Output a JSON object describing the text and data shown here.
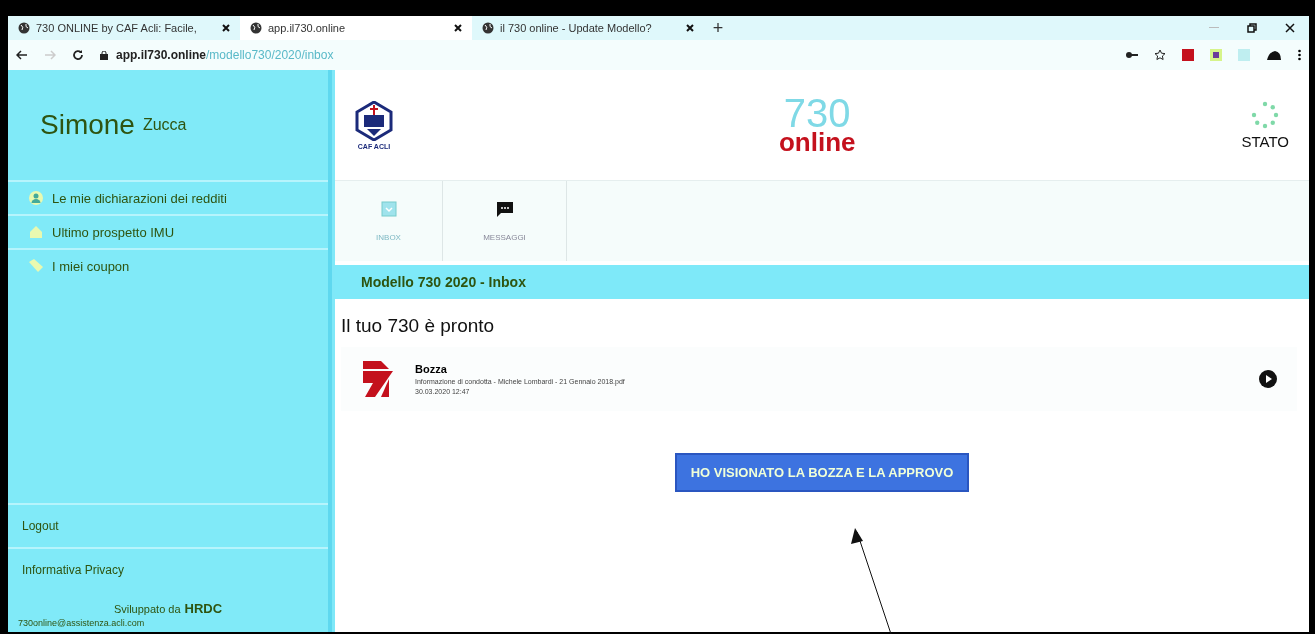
{
  "browser": {
    "tabs": [
      {
        "title": "730 ONLINE by CAF Acli: Facile,",
        "selected": false
      },
      {
        "title": "app.il730.online",
        "selected": true
      },
      {
        "title": "il 730 online - Update Modello?",
        "selected": false
      }
    ],
    "new_tab": "+",
    "url_host": "app.il730.online",
    "url_path": "/modello730/2020/inbox"
  },
  "sidebar": {
    "user_first": "Simone",
    "user_last": "Zucca",
    "items": [
      {
        "label": "Le mie dichiarazioni dei redditi",
        "kind": "person"
      },
      {
        "label": "Ultimo prospetto IMU",
        "kind": "house"
      },
      {
        "label": "I miei coupon",
        "kind": "tag"
      }
    ],
    "bottom_items": [
      "Logout",
      "Informativa Privacy"
    ],
    "credit_prefix": "Sviluppato da",
    "credit_brand": "HRDC",
    "footer_email": "730online@assistenza.acli.com"
  },
  "header": {
    "logo_caption": "CAF ACLI",
    "brand_number": "730",
    "brand_word": "online",
    "status_label": "STATO"
  },
  "nav": [
    {
      "label": "INBOX",
      "kind": "inbox",
      "selected": true
    },
    {
      "label": "MESSAGGI",
      "kind": "chat",
      "selected": false
    }
  ],
  "section_title": "Modello 730 2020 - Inbox",
  "heading": "Il tuo 730 è pronto",
  "document": {
    "title": "Bozza",
    "filename": "Informazione di condotta - Michele Lombardi - 21 Gennaio 2018.pdf",
    "date": "30.03.2020 12:47"
  },
  "approve_button": "HO VISIONATO LA BOZZA E LA APPROVO"
}
